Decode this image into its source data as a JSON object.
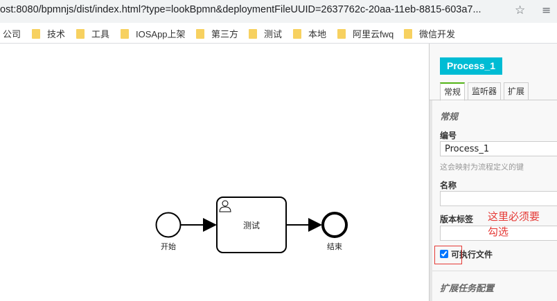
{
  "browser": {
    "url": "ost:8080/bpmnjs/dist/index.html?type=lookBpmn&deploymentFileUUID=2637762c-20aa-11eb-8815-603a7...",
    "star_icon": "☆",
    "menu_icon": "≡"
  },
  "bookmarks": [
    "公司",
    "技术",
    "工具",
    "IOSApp上架",
    "第三方",
    "测试",
    "本地",
    "阿里云fwq",
    "微信开发"
  ],
  "diagram": {
    "start_label": "开始",
    "task_label": "测试",
    "end_label": "结束",
    "annotation_line1": "这里必须要",
    "annotation_line2": "勾选"
  },
  "panel": {
    "process_title": "Process_1",
    "tabs": [
      "常规",
      "监听器",
      "扩展"
    ],
    "section_general": "常规",
    "id_label": "编号",
    "id_value": "Process_1",
    "id_desc": "这会映射为流程定义的键",
    "name_label": "名称",
    "name_value": "",
    "version_label": "版本标签",
    "version_value": "",
    "executable_label": "可执行文件",
    "executable_checked": true,
    "section_extension": "扩展任务配置"
  },
  "colors": {
    "accent": "#00bcd4",
    "tab_active": "#52b415",
    "annotation": "#e53935"
  }
}
